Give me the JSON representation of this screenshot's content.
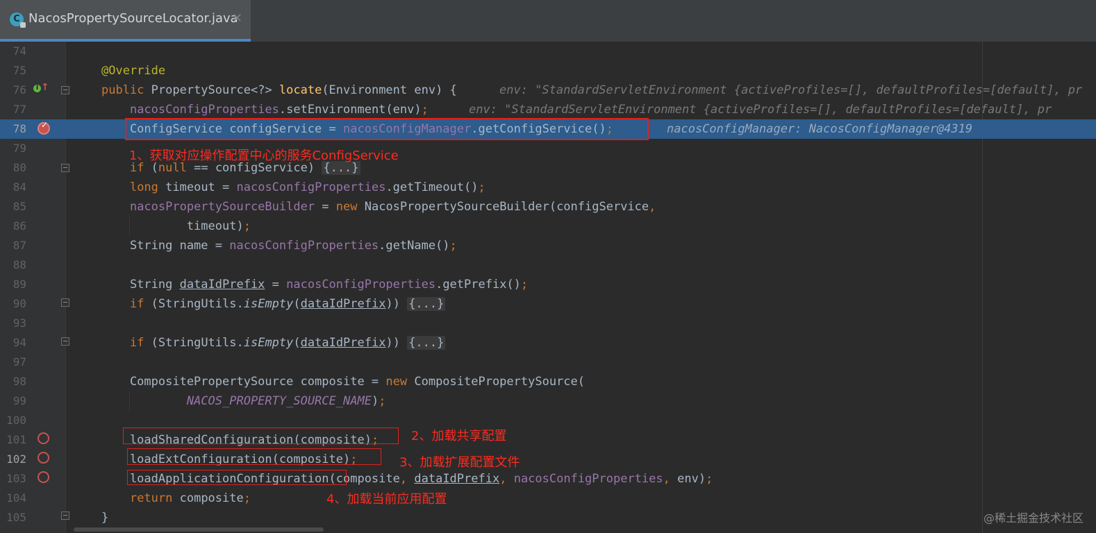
{
  "tab": {
    "title": "NacosPropertySourceLocator.java",
    "close": "✕",
    "icon": "java-class-icon"
  },
  "lines": [
    {
      "num": "74"
    },
    {
      "num": "75"
    },
    {
      "num": "76"
    },
    {
      "num": "77"
    },
    {
      "num": "78"
    },
    {
      "num": "79"
    },
    {
      "num": "80"
    },
    {
      "num": "84"
    },
    {
      "num": "85"
    },
    {
      "num": "86"
    },
    {
      "num": "87"
    },
    {
      "num": "88"
    },
    {
      "num": "89"
    },
    {
      "num": "90"
    },
    {
      "num": "93"
    },
    {
      "num": "94"
    },
    {
      "num": "97"
    },
    {
      "num": "98"
    },
    {
      "num": "99"
    },
    {
      "num": "100"
    },
    {
      "num": "101"
    },
    {
      "num": "102"
    },
    {
      "num": "103"
    },
    {
      "num": "104"
    },
    {
      "num": "105"
    }
  ],
  "hints": {
    "l76": "env: \"StandardServletEnvironment {activeProfiles=[], defaultProfiles=[default], pr",
    "l77": "env: \"StandardServletEnvironment {activeProfiles=[], defaultProfiles=[default], pr",
    "l78": "nacosConfigManager: NacosConfigManager@4319"
  },
  "annotations": {
    "a1": "1、获取对应操作配置中心的服务ConfigService",
    "a2": "2、加载共享配置",
    "a3": "3、加载扩展配置文件",
    "a4": "4、加载当前应用配置"
  },
  "watermark": "@稀土掘金技术社区",
  "colors": {
    "keyword": "#cc7832",
    "annotation": "#bbb529",
    "method": "#ffc66d",
    "field": "#9876aa",
    "default_text": "#a9b7c6",
    "highlight_line": "#2d5c8d",
    "note_red": "#ff2b1f"
  }
}
